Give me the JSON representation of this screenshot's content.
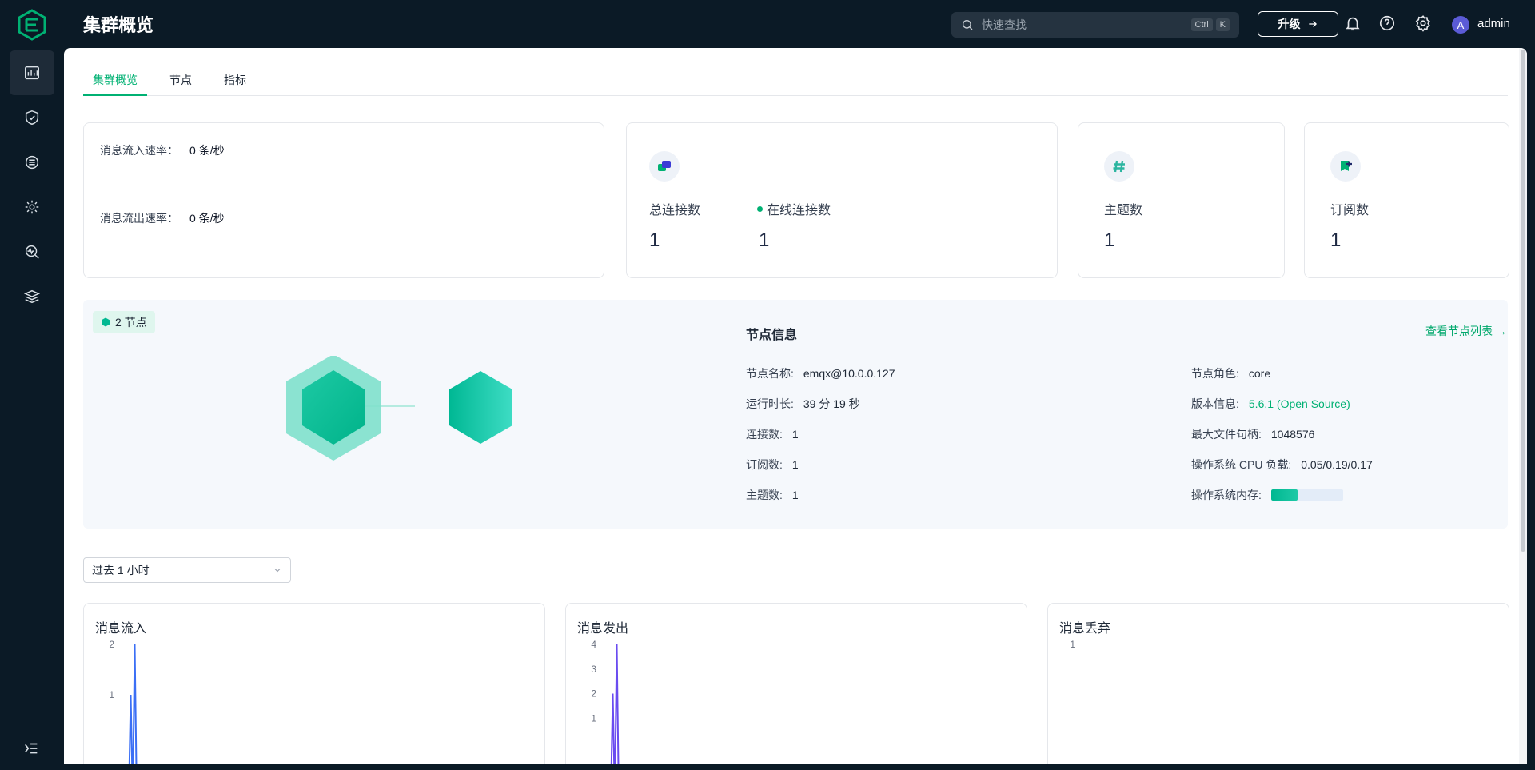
{
  "header": {
    "title": "集群概览",
    "search_placeholder": "快速查找",
    "kbd_ctrl": "Ctrl",
    "kbd_k": "K",
    "upgrade_label": "升级",
    "user_initial": "A",
    "user_name": "admin"
  },
  "tabs": [
    {
      "label": "集群概览",
      "active": true
    },
    {
      "label": "节点",
      "active": false
    },
    {
      "label": "指标",
      "active": false
    }
  ],
  "rates": {
    "in_label": "消息流入速率：",
    "in_value": "0 条/秒",
    "out_label": "消息流出速率：",
    "out_value": "0 条/秒"
  },
  "stats": {
    "total_conn_label": "总连接数",
    "total_conn_value": "1",
    "online_conn_label": "在线连接数",
    "online_conn_value": "1",
    "topics_label": "主题数",
    "topics_value": "1",
    "subs_label": "订阅数",
    "subs_value": "1"
  },
  "nodes": {
    "badge": "2 节点",
    "info_title": "节点信息",
    "view_list": "查看节点列表",
    "left": [
      {
        "label": "节点名称:",
        "value": "emqx@10.0.0.127"
      },
      {
        "label": "运行时长:",
        "value": "39 分 19 秒"
      },
      {
        "label": "连接数:",
        "value": "1"
      },
      {
        "label": "订阅数:",
        "value": "1"
      },
      {
        "label": "主题数:",
        "value": "1"
      }
    ],
    "right": [
      {
        "label": "节点角色:",
        "value": "core"
      },
      {
        "label": "版本信息:",
        "value": "5.6.1 (Open Source)"
      },
      {
        "label": "最大文件句柄:",
        "value": "1048576"
      },
      {
        "label": "操作系统 CPU 负载:",
        "value": "0.05/0.19/0.17"
      },
      {
        "label": "操作系统内存:",
        "value": ""
      }
    ],
    "memory_fraction": 0.37
  },
  "time_range": "过去 1 小时",
  "charts": [
    {
      "title": "消息流入",
      "ticks": [
        "2",
        "1"
      ]
    },
    {
      "title": "消息发出",
      "ticks": [
        "4",
        "3",
        "2",
        "1"
      ]
    },
    {
      "title": "消息丢弃",
      "ticks": [
        "1"
      ]
    }
  ],
  "colors": {
    "accent": "#00b173",
    "sidebar_bg": "#0b1a26",
    "series_in": "#3b6ff5",
    "series_out": "#6a4cf0"
  },
  "chart_data": [
    {
      "type": "line",
      "title": "消息流入",
      "ylim": [
        0,
        2
      ],
      "x": [
        0,
        1,
        2,
        3,
        4
      ],
      "values": [
        0,
        1,
        0,
        2,
        0
      ]
    },
    {
      "type": "line",
      "title": "消息发出",
      "ylim": [
        0,
        4
      ],
      "x": [
        0,
        1,
        2,
        3,
        4
      ],
      "values": [
        0,
        2,
        0,
        4,
        0
      ]
    },
    {
      "type": "line",
      "title": "消息丢弃",
      "ylim": [
        0,
        1
      ],
      "x": [],
      "values": []
    }
  ]
}
